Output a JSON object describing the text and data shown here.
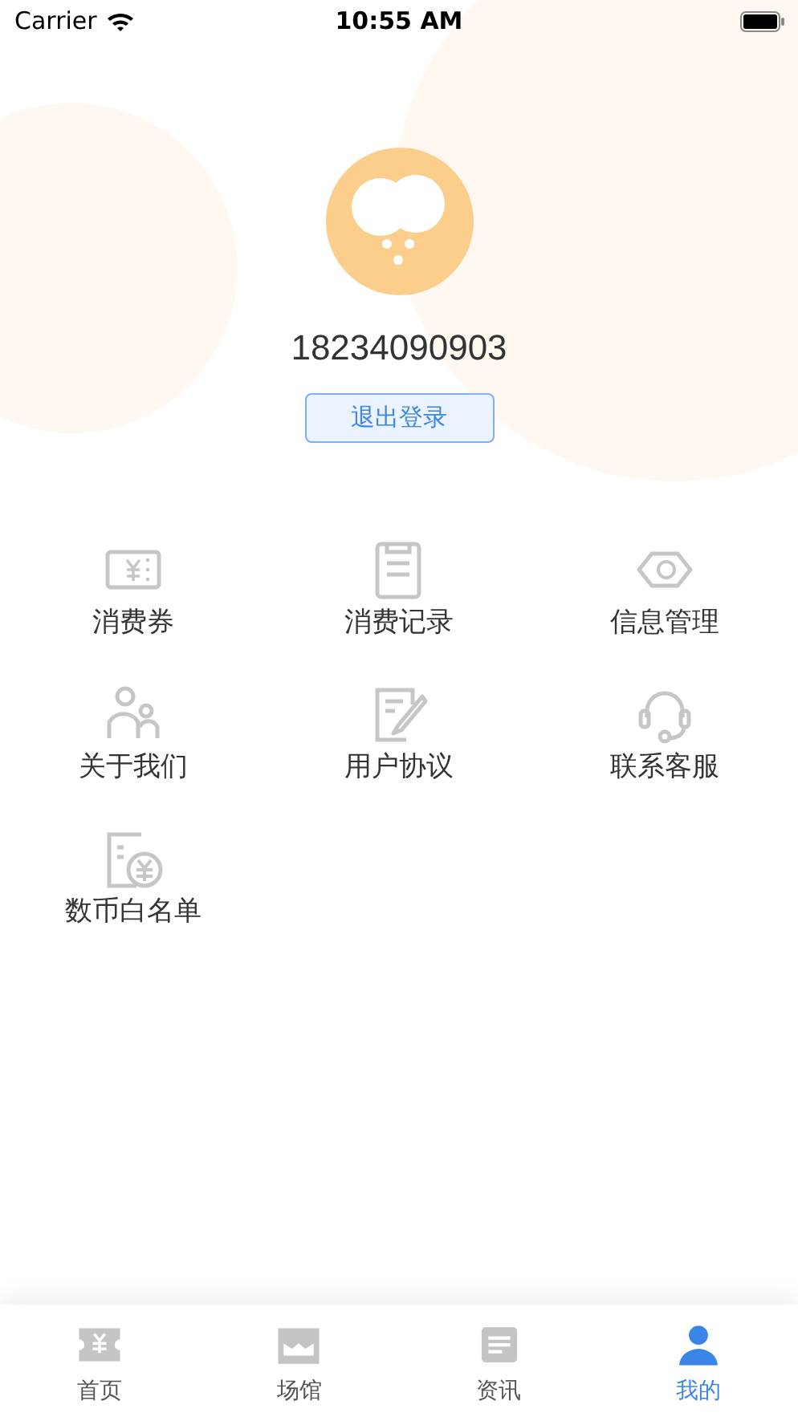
{
  "status_bar": {
    "carrier": "Carrier",
    "time": "10:55 AM"
  },
  "profile": {
    "phone": "18234090903",
    "logout_button": "退出登录"
  },
  "menu": [
    {
      "label": "消费券",
      "kind": "ticket"
    },
    {
      "label": "消费记录",
      "kind": "clipboard"
    },
    {
      "label": "信息管理",
      "kind": "eye"
    },
    {
      "label": "关于我们",
      "kind": "people"
    },
    {
      "label": "用户协议",
      "kind": "document"
    },
    {
      "label": "联系客服",
      "kind": "headset"
    },
    {
      "label": "数币白名单",
      "kind": "coinlist"
    }
  ],
  "tab_bar": [
    {
      "label": "首页",
      "kind": "ticket",
      "selected": false
    },
    {
      "label": "场馆",
      "kind": "store",
      "selected": false
    },
    {
      "label": "资讯",
      "kind": "news",
      "selected": false
    },
    {
      "label": "我的",
      "kind": "person",
      "selected": true
    }
  ]
}
